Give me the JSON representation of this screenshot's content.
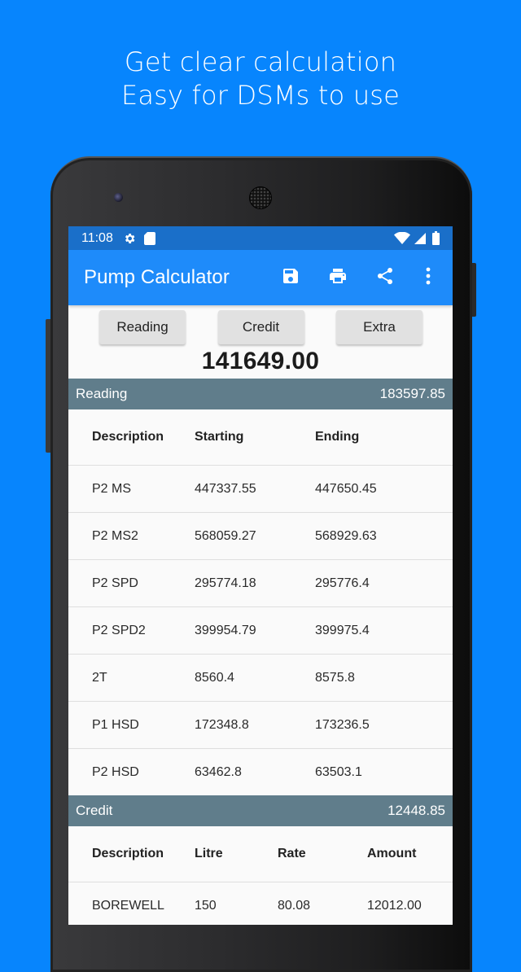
{
  "promo": {
    "line1": "Get clear calculation",
    "line2": "Easy for DSMs to use"
  },
  "statusbar": {
    "time": "11:08",
    "left_icons": [
      "gear-icon",
      "sd-card-icon"
    ],
    "right_icons": [
      "wifi-icon",
      "cellular-icon",
      "battery-icon"
    ]
  },
  "appbar": {
    "title": "Pump Calculator",
    "actions": [
      "save-icon",
      "print-icon",
      "share-icon",
      "more-vert-icon"
    ]
  },
  "tabs": [
    {
      "label": "Reading"
    },
    {
      "label": "Credit"
    },
    {
      "label": "Extra"
    }
  ],
  "total": "141649.00",
  "reading": {
    "title": "Reading",
    "total": "183597.85",
    "headers": [
      "Description",
      "Starting",
      "Ending"
    ],
    "rows": [
      [
        "P2 MS",
        "447337.55",
        "447650.45"
      ],
      [
        "P2 MS2",
        "568059.27",
        "568929.63"
      ],
      [
        "P2 SPD",
        "295774.18",
        "295776.4"
      ],
      [
        "P2 SPD2",
        "399954.79",
        "399975.4"
      ],
      [
        "2T",
        "8560.4",
        "8575.8"
      ],
      [
        "P1 HSD",
        "172348.8",
        "173236.5"
      ],
      [
        "P2 HSD",
        "63462.8",
        "63503.1"
      ]
    ]
  },
  "credit": {
    "title": "Credit",
    "total": "12448.85",
    "headers": [
      "Description",
      "Litre",
      "Rate",
      "Amount"
    ],
    "rows": [
      [
        "BOREWELL",
        "150",
        "80.08",
        "12012.00"
      ]
    ]
  },
  "colors": {
    "background": "#0785fd",
    "statusbar": "#1a6fc9",
    "appbar": "#1e8bfa",
    "section_header": "#607d8b",
    "tab_button": "#e1e1e1"
  }
}
